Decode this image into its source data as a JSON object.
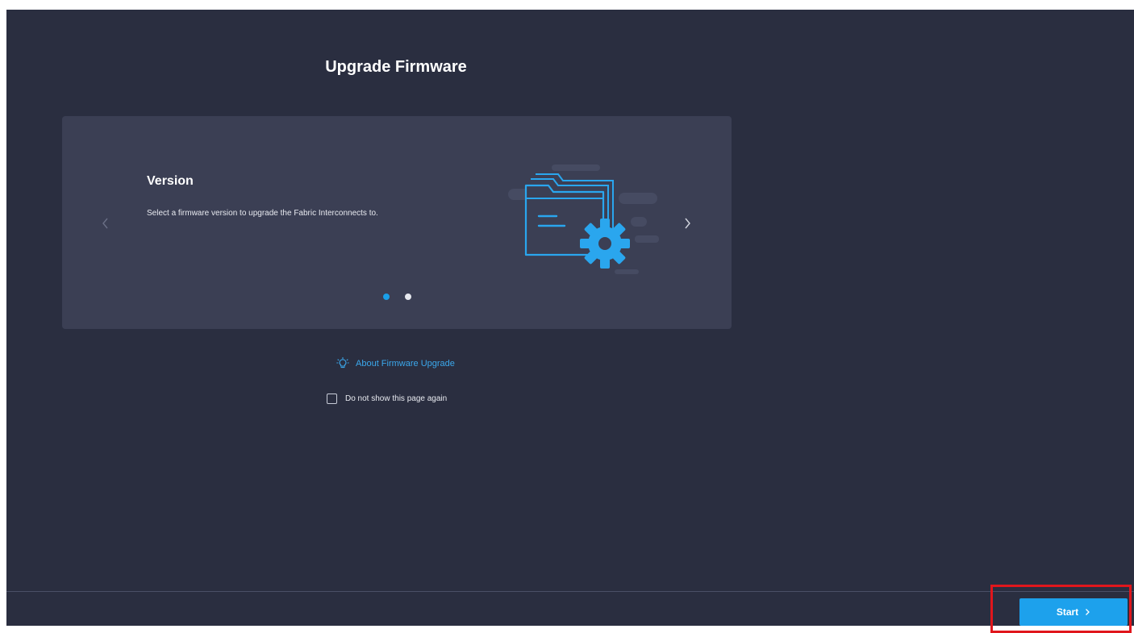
{
  "page": {
    "title": "Upgrade Firmware"
  },
  "carousel": {
    "slide": {
      "title": "Version",
      "description": "Select a firmware version to upgrade the Fabric Interconnects to.",
      "illustration_icon": "folder-gear-icon"
    },
    "slide_count": 2,
    "active_slide": 1,
    "prev_icon": "chevron-left-icon",
    "next_icon": "chevron-right-icon"
  },
  "about_link": {
    "icon": "lightbulb-icon",
    "label": "About Firmware Upgrade"
  },
  "dont_show": {
    "label": "Do not show this page again",
    "checked": false
  },
  "footer": {
    "start_label": "Start",
    "start_icon": "chevron-right-icon"
  },
  "colors": {
    "background": "#2a2e40",
    "card": "#3b3f54",
    "accent": "#1da1ec",
    "link": "#3ba8ec",
    "highlight": "#e0161c"
  }
}
